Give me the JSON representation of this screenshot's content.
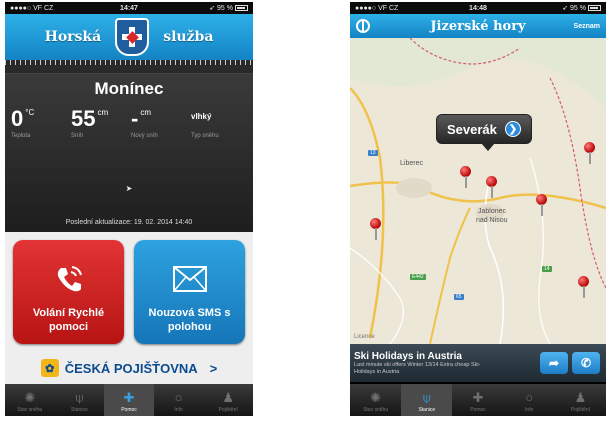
{
  "left": {
    "status": {
      "carrier": "●●●●○ VF CZ",
      "time": "14:47",
      "battery": "95 %"
    },
    "header": {
      "word_left": "Horská",
      "word_right": "služba"
    },
    "location": "Monínec",
    "stats": [
      {
        "value": "0",
        "unit": "°C",
        "label": "Teplota"
      },
      {
        "value": "55",
        "unit": "cm",
        "label": "Sníh"
      },
      {
        "value": "-",
        "unit": "cm",
        "label": "Nový sníh"
      },
      {
        "value": "vlhký",
        "unit": "",
        "label": "Typ sněhu"
      }
    ],
    "wind_icon": "➤",
    "last_update": "Poslední aktualizace: 19. 02. 2014 14:40",
    "actions": {
      "call_label": "Volání Rychlé pomoci",
      "sms_label": "Nouzová SMS s polohou"
    },
    "insurance": {
      "text": "ČESKÁ POJIŠŤOVNA",
      "arrow": ">"
    },
    "tabs": [
      {
        "label": "Stav sněhu",
        "icon": "✺"
      },
      {
        "label": "Stanice",
        "icon": "⍦"
      },
      {
        "label": "Pomoc",
        "icon": "✚",
        "active": true
      },
      {
        "label": "Info",
        "icon": "○"
      },
      {
        "label": "Pojištění",
        "icon": "♟"
      }
    ]
  },
  "right": {
    "status": {
      "carrier": "●●●●○ VF CZ",
      "time": "14:48",
      "battery": "95 %"
    },
    "header": {
      "title": "Jizerské hory",
      "list_label": "Seznam"
    },
    "map": {
      "callout": "Severák",
      "cities": [
        "Liberec",
        "Jablonec",
        "nad Nisou"
      ],
      "road_badges": [
        "13",
        "E442",
        "65",
        "14"
      ],
      "legal": "Licence"
    },
    "ad": {
      "title": "Ski Holidays in Austria",
      "subtitle": "Last minute ski offers Winter 13/14 Extra cheap Ski-Holidays in Austria"
    },
    "tabs": [
      {
        "label": "Stav sněhu",
        "icon": "✺"
      },
      {
        "label": "Stanice",
        "icon": "⍦",
        "active": true
      },
      {
        "label": "Pomoc",
        "icon": "✚"
      },
      {
        "label": "Info",
        "icon": "○"
      },
      {
        "label": "Pojištění",
        "icon": "♟"
      }
    ]
  },
  "colors": {
    "header_blue": "#1e9ad8",
    "call_red": "#d62222",
    "sms_blue": "#1f8ccf",
    "insurance_blue": "#0b4b8f"
  }
}
